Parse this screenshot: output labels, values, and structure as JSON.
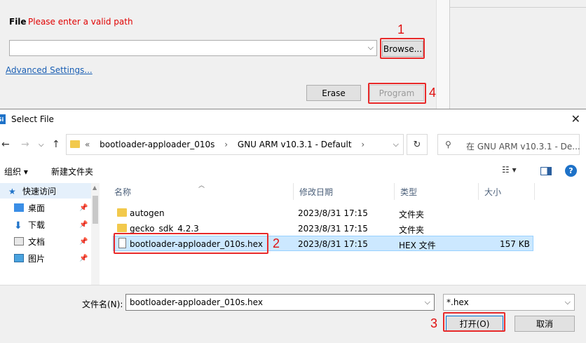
{
  "commander": {
    "file_label": "File",
    "file_error": "Please enter a valid path",
    "path_value": "",
    "browse_label": "Browse...",
    "advanced_link": "Advanced Settings...",
    "erase_label": "Erase",
    "program_label": "Program"
  },
  "steps": {
    "s1": "1",
    "s2": "2",
    "s3": "3",
    "s4": "4"
  },
  "dialog": {
    "title": "Select File",
    "breadcrumb": [
      "«",
      "bootloader-apploader_010s",
      "GNU ARM v10.3.1 - Default"
    ],
    "search_placeholder": "在 GNU ARM v10.3.1 - De...",
    "organize_label": "组织",
    "new_folder_label": "新建文件夹",
    "nav_items": [
      {
        "label": "快速访问"
      },
      {
        "label": "桌面"
      },
      {
        "label": "下载"
      },
      {
        "label": "文档"
      },
      {
        "label": "图片"
      }
    ],
    "columns": {
      "name": "名称",
      "modified": "修改日期",
      "type": "类型",
      "size": "大小"
    },
    "files": [
      {
        "name": "autogen",
        "modified": "2023/8/31 17:15",
        "type": "文件夹",
        "size": ""
      },
      {
        "name": "gecko_sdk_4.2.3",
        "modified": "2023/8/31 17:15",
        "type": "文件夹",
        "size": ""
      },
      {
        "name": "bootloader-apploader_010s.hex",
        "modified": "2023/8/31 17:15",
        "type": "HEX 文件",
        "size": "157 KB"
      }
    ],
    "filename_label": "文件名(N):",
    "filename_value": "bootloader-apploader_010s.hex",
    "filter_value": "*.hex",
    "open_label": "打开(O)",
    "cancel_label": "取消"
  },
  "colors": {
    "accent": "#0078d7",
    "annotation_red": "#e82a2a",
    "error_text": "#e00000"
  }
}
